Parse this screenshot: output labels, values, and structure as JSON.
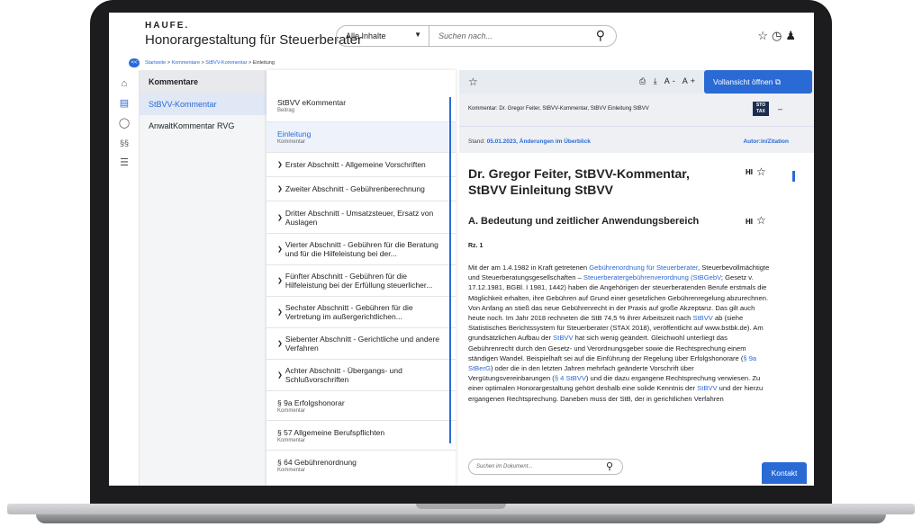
{
  "header": {
    "logo": "HAUFE.",
    "app_title": "Honorargestaltung für Steuerberater",
    "scope_select": "Alle Inhalte",
    "search_placeholder": "Suchen nach..."
  },
  "breadcrumb": {
    "toggle": "<<",
    "items": [
      "Startseite",
      "Kommentare",
      "StBVV-Kommentar",
      "Einleitung"
    ],
    "separator": ">"
  },
  "left_rail": {
    "icons": [
      "home-icon",
      "document-icon",
      "lightbulb-icon",
      "paragraph-icon",
      "list-icon"
    ],
    "paragraph_glyph": "§§"
  },
  "kommentare_panel": {
    "heading": "Kommentare",
    "items": [
      {
        "label": "StBVV-Kommentar",
        "active": true
      },
      {
        "label": "AnwaltKommentar RVG",
        "active": false
      }
    ]
  },
  "toc": {
    "items": [
      {
        "title": "StBVV eKommentar",
        "sub": "Beitrag"
      },
      {
        "title": "Einleitung",
        "sub": "Kommentar"
      },
      {
        "title": "Erster Abschnitt - Allgemeine Vorschriften",
        "sub": ""
      },
      {
        "title": "Zweiter Abschnitt - Gebührenberechnung",
        "sub": ""
      },
      {
        "title": "Dritter Abschnitt - Umsatzsteuer, Ersatz von Auslagen",
        "sub": ""
      },
      {
        "title": "Vierter Abschnitt - Gebühren für die Beratung und für die Hilfeleistung bei der...",
        "sub": ""
      },
      {
        "title": "Fünfter Abschnitt - Gebühren für die Hilfeleistung bei der Erfüllung steuerlicher...",
        "sub": ""
      },
      {
        "title": "Sechster Abschnitt - Gebühren für die Vertretung im außergerichtlichen...",
        "sub": ""
      },
      {
        "title": "Siebenter Abschnitt - Gerichtliche und andere Verfahren",
        "sub": ""
      },
      {
        "title": "Achter Abschnitt - Übergangs- und Schlußvorschriften",
        "sub": ""
      },
      {
        "title": "§ 9a Erfolgshonorar",
        "sub": "Kommentar"
      },
      {
        "title": "§ 57 Allgemeine Berufspflichten",
        "sub": "Kommentar"
      },
      {
        "title": "§ 64 Gebührenordnung",
        "sub": "Kommentar"
      }
    ]
  },
  "document": {
    "toolbar": {
      "font_smaller": "A-",
      "font_larger": "A+",
      "full_view_button": "Vollansicht öffnen"
    },
    "meta": "Kommentar: Dr. Gregor Feiter, StBVV-Kommentar, StBVV Einleitung StBVV",
    "stotax_logo": "STO TAX",
    "collapse": "–",
    "stand_label": "Stand:",
    "stand_value": "05.01.2023, Änderungen im Überblick",
    "author_link": "Autor:in/Zitation",
    "title": "Dr. Gregor Feiter, StBVV-Kommentar, StBVV Einleitung StBVV",
    "hi_label": "HI",
    "section_title": "A. Bedeutung und zeitlicher Anwendungsbereich",
    "rz": "Rz. 1",
    "body": {
      "p1": "Mit der am 1.4.1982 in Kraft getretenen ",
      "l1": "Gebührenordnung für Steuerberater",
      "p2": ", Steuerbevollmächtigte und Steuerberatungsgesellschaften – ",
      "l2": "Steuerberatergebührenverordnung (StBGebV",
      "p3": "; Gesetz v. 17.12.1981, BGBl. I 1981, 1442) haben die Angehörigen der steuerberatenden Berufe erstmals die Möglichkeit erhalten, ihre Gebühren auf Grund einer gesetzlichen Gebührenregelung abzurechnen. Von Anfang an stieß das neue Gebührenrecht in der Praxis auf große Akzeptanz. Das gilt auch heute noch. Im Jahr 2018 rechneten die StB 74,5 % ihrer Arbeitszeit nach ",
      "l3": "StBVV",
      "p4": " ab (siehe Statistisches Berichtssystem für Steuerberater (STAX 2018), veröffentlicht auf www.bstbk.de). Am grundsätzlichen Aufbau der ",
      "l4": "StBVV",
      "p5": " hat sich wenig geändert. Gleichwohl unterliegt das Gebührenrecht durch den Gesetz- und Verordnungsgeber sowie die Rechtsprechung einem ständigen Wandel. Beispielhaft sei auf die Einführung der Regelung über Erfolgshonorare (",
      "l5": "§ 9a StBerG",
      "p6": ") oder die in den letzten Jahren mehrfach geänderte Vorschrift über Vergütungsvereinbarungen (",
      "l6": "§ 4 StBVV",
      "p7": ") und die dazu ergangene Rechtsprechung verwiesen. Zu einer optimalen Honorargestaltung gehört deshalb eine solide Kenntnis der ",
      "l7": "StBVV",
      "p8": " und der hierzu ergangenen Rechtsprechung. Daneben muss der StB, der in gerichtlichen Verfahren"
    },
    "search_placeholder": "Suchen im Dokument...",
    "contact_button": "Kontakt"
  }
}
